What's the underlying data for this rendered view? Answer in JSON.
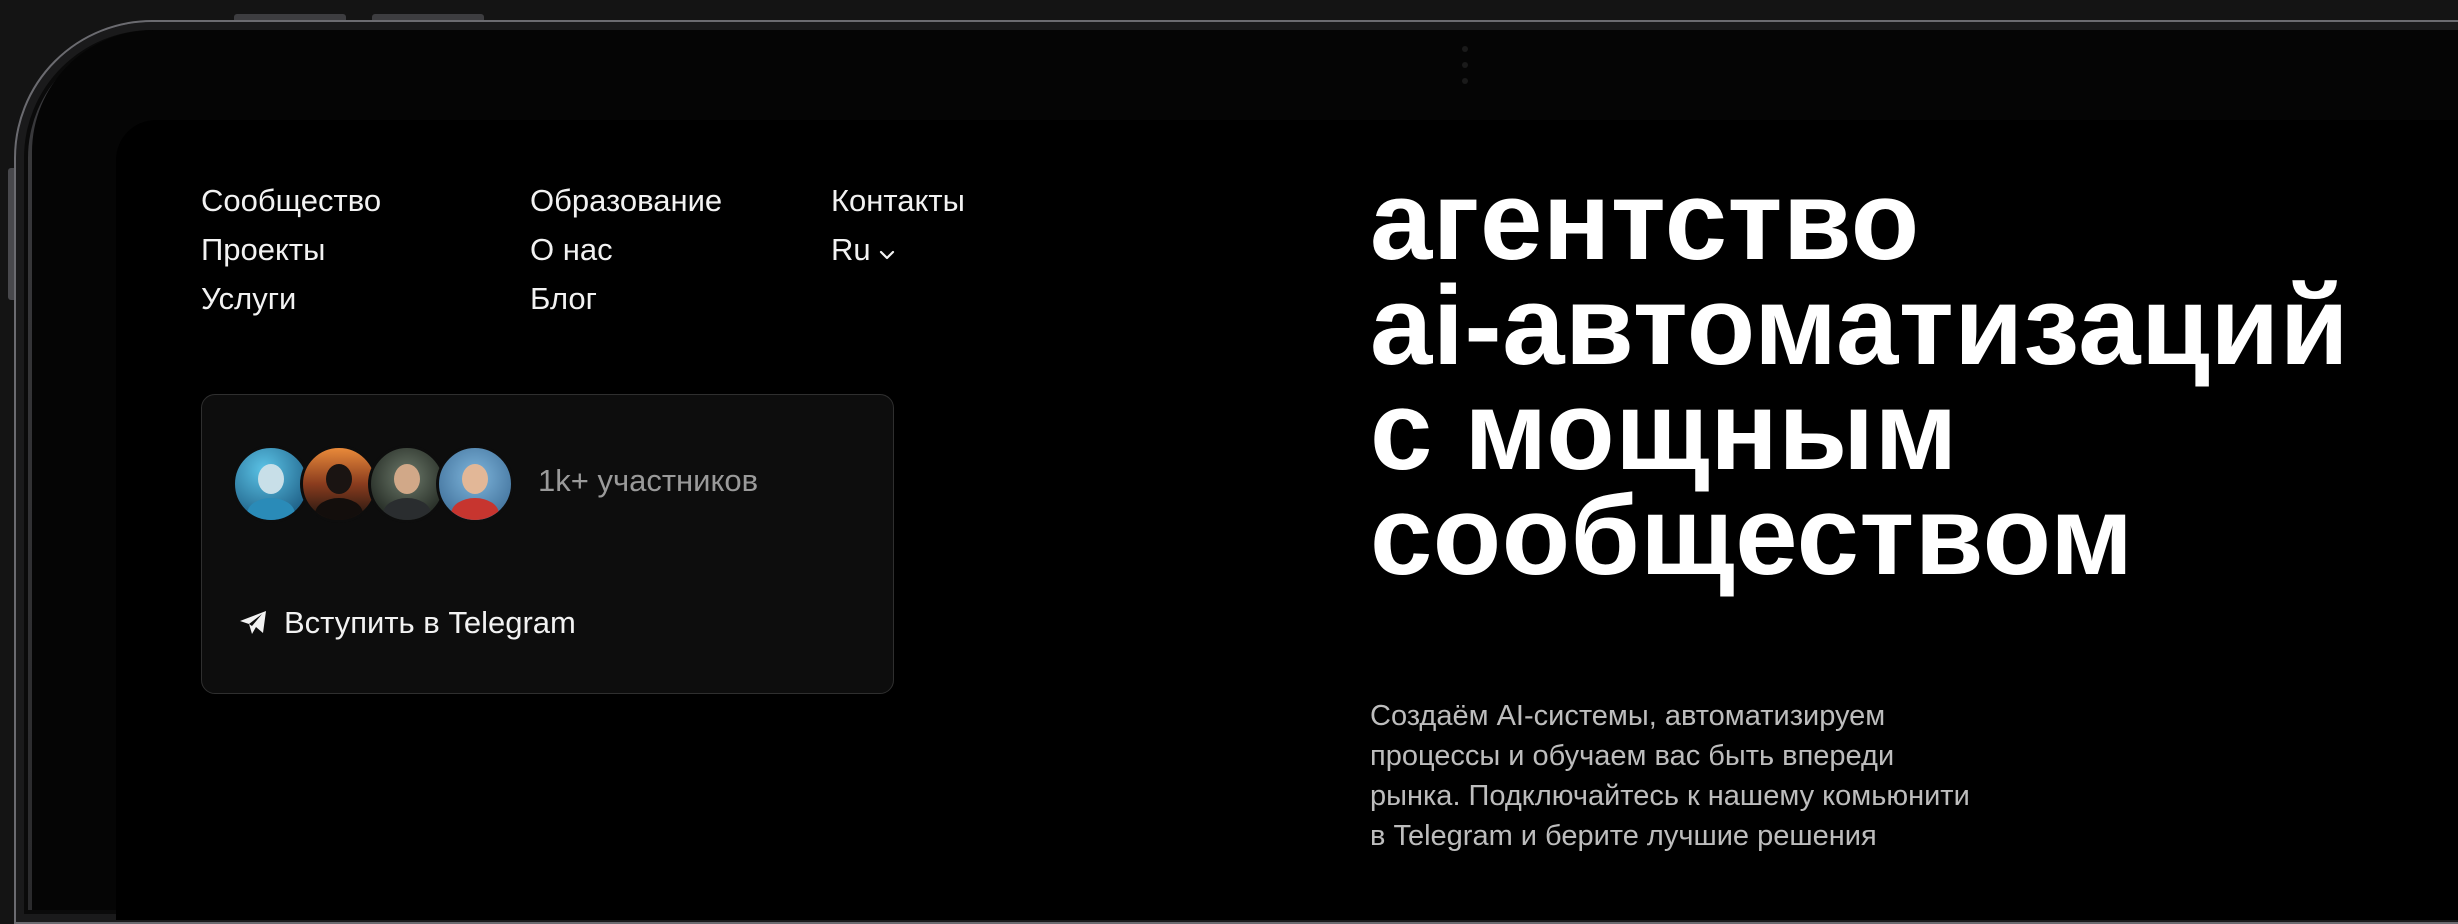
{
  "nav": {
    "col1": [
      "Сообщество",
      "Проекты",
      "Услуги"
    ],
    "col2": [
      "Образование",
      "О нас",
      "Блог"
    ],
    "col3": [
      "Контакты"
    ],
    "language": "Ru"
  },
  "community_card": {
    "members_label": "1k+ участников",
    "join_button": "Вступить в Telegram",
    "avatars": [
      "avatar-1",
      "avatar-2",
      "avatar-3",
      "avatar-4"
    ]
  },
  "hero": {
    "headline_lines": [
      "агентство",
      "ai-автоматизаций",
      "с мощным",
      "сообществом"
    ],
    "subtitle_lines": [
      "Создаём AI-системы, автоматизируем",
      "процессы и обучаем вас быть впереди",
      "рынка. Подключайтесь к нашему комьюнити",
      "в Telegram и берите лучшие решения"
    ]
  },
  "colors": {
    "background": "#000000",
    "text": "#ffffff",
    "muted": "#9a9a9a",
    "card_border": "#2f2f2f"
  },
  "icons": {
    "language": "chevron-down-icon",
    "join": "telegram-icon"
  }
}
